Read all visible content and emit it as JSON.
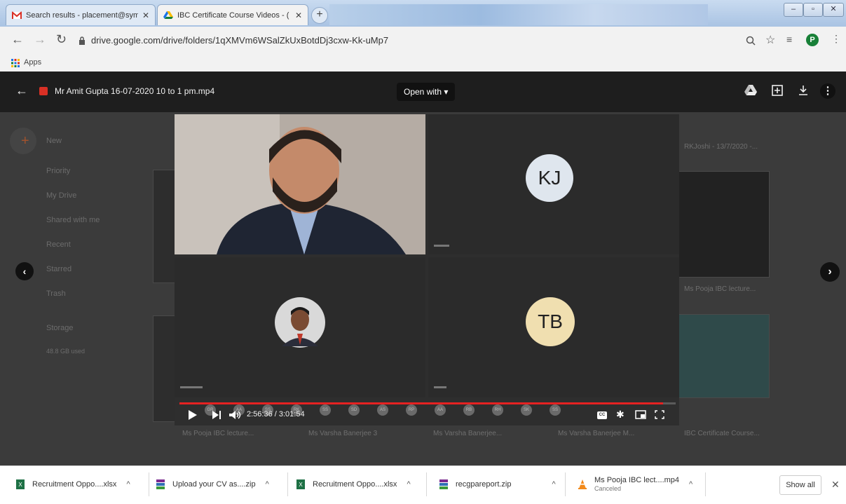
{
  "browser": {
    "tabs": [
      {
        "title": "Search results - placement@sym",
        "icon": "gmail-icon"
      },
      {
        "title": "IBC Certificate Course Videos - (",
        "icon": "drive-icon"
      }
    ],
    "new_tab_symbol": "+",
    "window_controls": [
      "–",
      "▫",
      "✕"
    ],
    "url": "drive.google.com/drive/folders/1qXMVm6WSalZkUxBotdDj3cxw-Kk-uMp7",
    "bookmarks_apps_label": "Apps",
    "profile_initial": "P"
  },
  "viewer": {
    "file_title": "Mr Amit Gupta 16-07-2020 10 to 1 pm.mp4",
    "open_with_label": "Open with",
    "background_sidebar": [
      "New",
      "Priority",
      "My Drive",
      "Shared with me",
      "Recent",
      "Starred",
      "Trash",
      "Storage",
      "48.8 GB used"
    ],
    "background_files": [
      "Ms Pooja IBC lecture...",
      "Ms Varsha Banerjee 3",
      "Ms Varsha Banerjee...",
      "Ms Varsha Banerjee M...",
      "IBC Certificate Course...",
      "Ms Pooja IBC lecture...",
      "RKJoshi - 13/7/2020 -..."
    ]
  },
  "video": {
    "participants": [
      {
        "initials": "KJ"
      },
      {
        "initials": "TB"
      }
    ],
    "time_display": "2:56:36 / 3:01:54",
    "progress": 0.975,
    "chips": [
      "GR",
      "AA",
      "SS",
      "RK",
      "SS",
      "SD",
      "AS",
      "RP",
      "AA",
      "RB",
      "RH",
      "SK",
      "SS"
    ]
  },
  "downloads": [
    {
      "name": "Recruitment Oppo....xlsx",
      "icon": "excel-icon",
      "status": ""
    },
    {
      "name": "Upload your CV as....zip",
      "icon": "winrar-icon",
      "status": ""
    },
    {
      "name": "Recruitment Oppo....xlsx",
      "icon": "excel-icon",
      "status": ""
    },
    {
      "name": "recgpareport.zip",
      "icon": "winrar-icon",
      "status": ""
    },
    {
      "name": "Ms Pooja IBC lect....mp4",
      "icon": "vlc-icon",
      "status": "Canceled"
    }
  ],
  "show_all_label": "Show all",
  "colors": {
    "accent_red": "#e52222",
    "drive_red": "#d93025",
    "profile_green": "#188038"
  }
}
